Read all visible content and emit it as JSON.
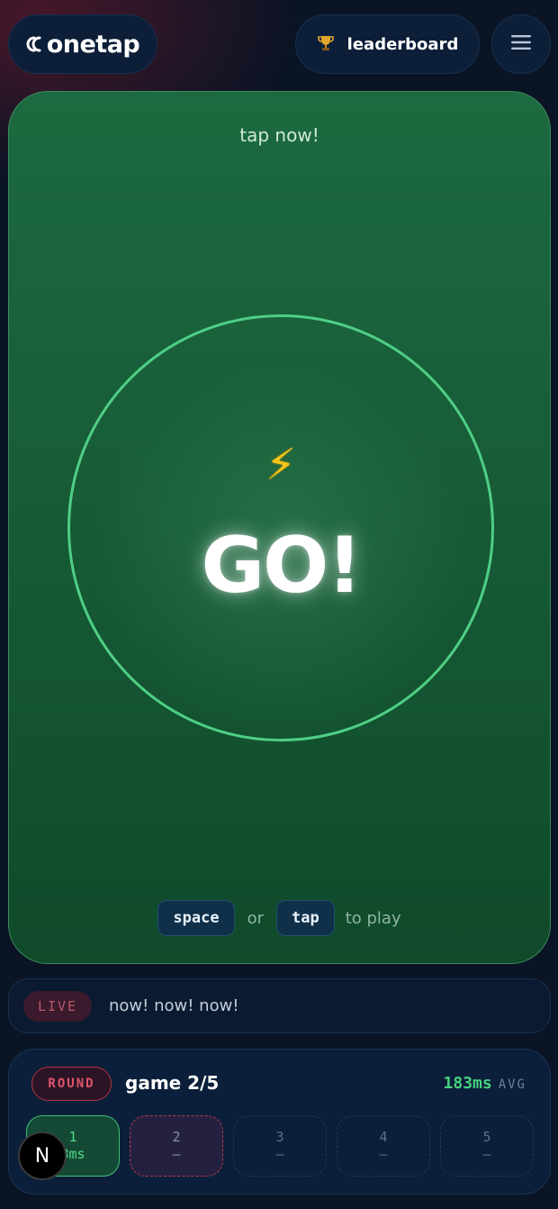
{
  "header": {
    "logo_text": "onetap",
    "leaderboard_label": "leaderboard",
    "trophy_icon": "trophy-icon",
    "menu_icon": "hamburger-menu-icon"
  },
  "game": {
    "status_text": "tap now!",
    "bolt_icon": "⚡",
    "go_text": "GO!",
    "hint": {
      "key_space": "space",
      "or_text": "or",
      "key_tap": "tap",
      "suffix": "to play"
    },
    "colors": {
      "panel_green": "#175c37",
      "ring_green": "#4fcf85"
    }
  },
  "live": {
    "badge": "LIVE",
    "message": "now! now! now!"
  },
  "round": {
    "badge": "ROUND",
    "game_count": "game 2/5",
    "avg_value": "183ms",
    "avg_label": "AVG",
    "slots": [
      {
        "num": "1",
        "value": "3ms",
        "state": "done"
      },
      {
        "num": "2",
        "value": "–",
        "state": "current"
      },
      {
        "num": "3",
        "value": "–",
        "state": "pending"
      },
      {
        "num": "4",
        "value": "–",
        "state": "pending"
      },
      {
        "num": "5",
        "value": "–",
        "state": "pending"
      }
    ]
  },
  "dev_badge": "N"
}
